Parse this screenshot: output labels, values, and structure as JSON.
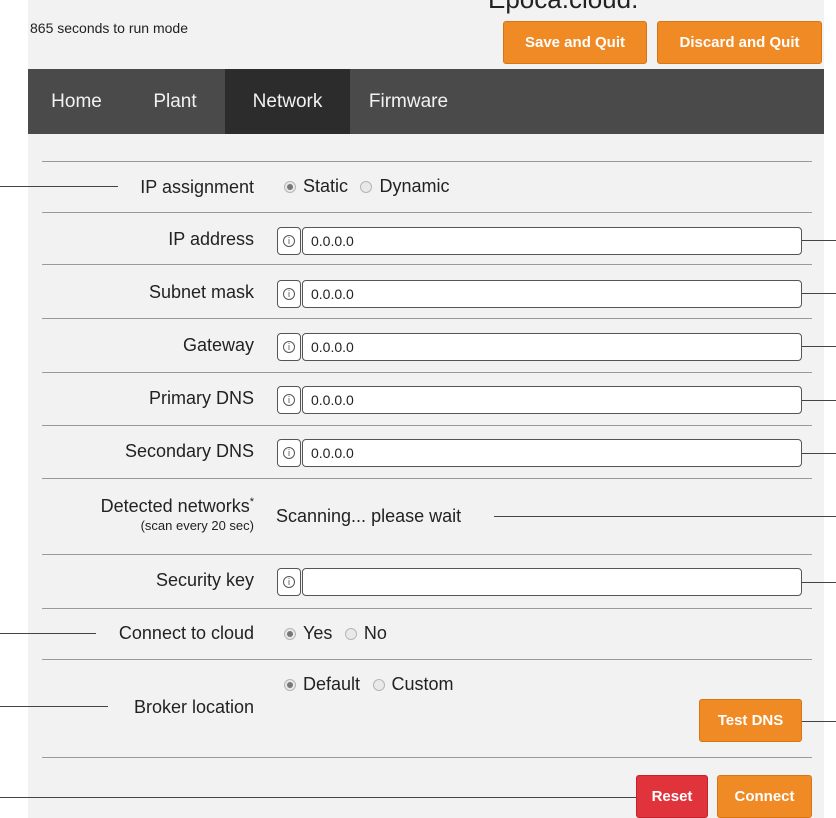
{
  "header": {
    "countdown_text": "865 seconds to run mode",
    "clipped_title": "Epoca.cloud.",
    "save_quit_label": "Save and Quit",
    "discard_quit_label": "Discard and Quit"
  },
  "nav": {
    "tabs": [
      {
        "label": "Home"
      },
      {
        "label": "Plant"
      },
      {
        "label": "Network",
        "active": true
      },
      {
        "label": "Firmware"
      }
    ]
  },
  "form": {
    "ip_assignment": {
      "label": "IP assignment",
      "options": [
        "Static",
        "Dynamic"
      ],
      "selected": "Static"
    },
    "ip_address": {
      "label": "IP address",
      "value": "0.0.0.0"
    },
    "subnet_mask": {
      "label": "Subnet mask",
      "value": "0.0.0.0"
    },
    "gateway": {
      "label": "Gateway",
      "value": "0.0.0.0"
    },
    "primary_dns": {
      "label": "Primary DNS",
      "value": "0.0.0.0"
    },
    "secondary_dns": {
      "label": "Secondary DNS",
      "value": "0.0.0.0"
    },
    "detected_networks": {
      "label": "Detected networks",
      "asterisk": "*",
      "sublabel": "(scan every 20 sec)",
      "status": "Scanning... please wait"
    },
    "security_key": {
      "label": "Security key",
      "value": ""
    },
    "connect_cloud": {
      "label": "Connect to cloud",
      "options": [
        "Yes",
        "No"
      ],
      "selected": "Yes"
    },
    "broker_location": {
      "label": "Broker location",
      "options": [
        "Default",
        "Custom"
      ],
      "selected": "Default",
      "test_dns_label": "Test DNS"
    }
  },
  "footer": {
    "reset_label": "Reset",
    "connect_label": "Connect"
  },
  "icons": {
    "info": "info-icon"
  },
  "colors": {
    "accent_orange": "#f08a24",
    "danger_red": "#e0333c",
    "nav_bg": "#4a4a4a",
    "nav_active": "#2c2c2c",
    "panel_bg": "#f2f2f2"
  }
}
